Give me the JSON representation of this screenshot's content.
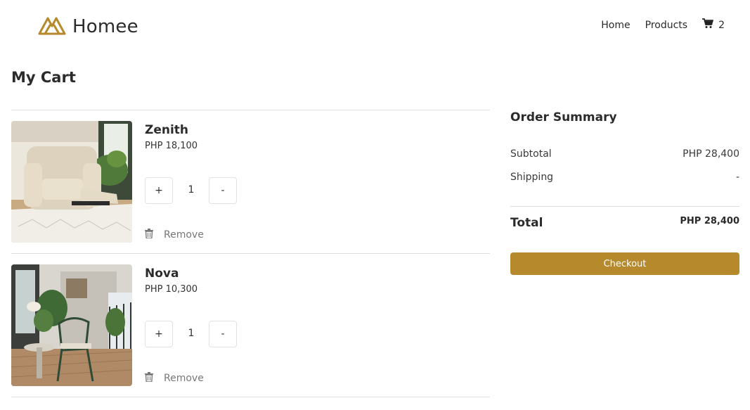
{
  "brand": {
    "name": "Homee",
    "accent_color": "#b68a2c",
    "logo_icon": "homee-logo-icon"
  },
  "nav": {
    "items": [
      {
        "label": "Home"
      },
      {
        "label": "Products"
      }
    ],
    "cart_icon": "cart-icon",
    "cart_count": "2"
  },
  "page": {
    "title": "My Cart"
  },
  "cart": {
    "items": [
      {
        "name": "Zenith",
        "price": "PHP 18,100",
        "quantity": "1",
        "plus": "+",
        "minus": "-",
        "remove_label": "Remove",
        "image": "recliner-armchair-photo"
      },
      {
        "name": "Nova",
        "price": "PHP 10,300",
        "quantity": "1",
        "plus": "+",
        "minus": "-",
        "remove_label": "Remove",
        "image": "patio-chair-photo"
      }
    ],
    "remove_icon": "trash-icon"
  },
  "summary": {
    "title": "Order Summary",
    "subtotal_label": "Subtotal",
    "subtotal_value": "PHP 28,400",
    "shipping_label": "Shipping",
    "shipping_value": "-",
    "total_label": "Total",
    "total_value": "PHP 28,400",
    "checkout_label": "Checkout"
  }
}
